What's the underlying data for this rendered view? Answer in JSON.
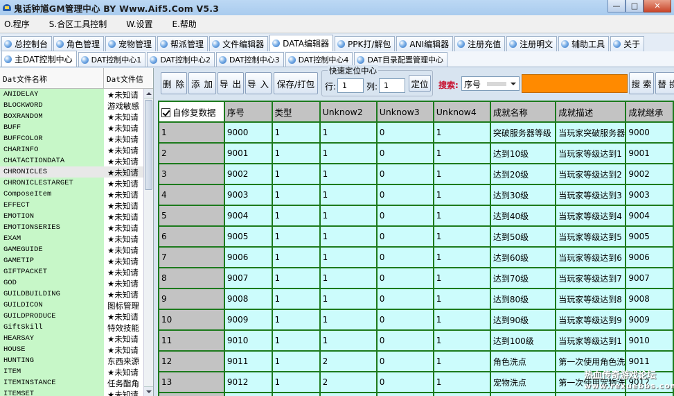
{
  "window": {
    "title": "鬼话钟馗GM管理中心 BY Www.Aif5.Com  V5.3",
    "controls": [
      "—",
      "□",
      "✕"
    ]
  },
  "menu": [
    "O.程序",
    "S.合区工具控制",
    "W.设置",
    "E.帮助"
  ],
  "main_tabs": [
    {
      "label": "总控制台",
      "active": false
    },
    {
      "label": "角色管理",
      "active": false
    },
    {
      "label": "宠物管理",
      "active": false
    },
    {
      "label": "帮派管理",
      "active": false
    },
    {
      "label": "文件编辑器",
      "active": false
    },
    {
      "label": "DATA编辑器",
      "active": true
    },
    {
      "label": "PPK打/解包",
      "active": false
    },
    {
      "label": "ANI编辑器",
      "active": false
    },
    {
      "label": "注册充值",
      "active": false
    },
    {
      "label": "注册明文",
      "active": false
    },
    {
      "label": "辅助工具",
      "active": false
    },
    {
      "label": "关于",
      "active": false
    }
  ],
  "sub_tabs": [
    {
      "label": "主DAT控制中心",
      "active": true
    },
    {
      "label": "DAT控制中心1",
      "active": false
    },
    {
      "label": "DAT控制中心2",
      "active": false
    },
    {
      "label": "DAT控制中心3",
      "active": false
    },
    {
      "label": "DAT控制中心4",
      "active": false
    },
    {
      "label": "DAT目录配置管理中心",
      "active": false
    }
  ],
  "file_list": {
    "headers": [
      "Dat文件名称",
      "Dat文件信"
    ],
    "rows": [
      {
        "name": "ANIDELAY",
        "desc": "★未知请"
      },
      {
        "name": "BLOCKWORD",
        "desc": "游戏敏感"
      },
      {
        "name": "BOXRANDOM",
        "desc": "★未知请"
      },
      {
        "name": "BUFF",
        "desc": "★未知请"
      },
      {
        "name": "BUFFCOLOR",
        "desc": "★未知请"
      },
      {
        "name": "CHARINFO",
        "desc": "★未知请"
      },
      {
        "name": "CHATACTIONDATA",
        "desc": "★未知请"
      },
      {
        "name": "CHRONICLES",
        "desc": "★未知请",
        "selected": true
      },
      {
        "name": "CHRONICLESTARGET",
        "desc": "★未知请"
      },
      {
        "name": "ComposeItem",
        "desc": "★未知请"
      },
      {
        "name": "EFFECT",
        "desc": "★未知请"
      },
      {
        "name": "EMOTION",
        "desc": "★未知请"
      },
      {
        "name": "EMOTIONSERIES",
        "desc": "★未知请"
      },
      {
        "name": "EXAM",
        "desc": "★未知请"
      },
      {
        "name": "GAMEGUIDE",
        "desc": "★未知请"
      },
      {
        "name": "GAMETIP",
        "desc": "★未知请"
      },
      {
        "name": "GIFTPACKET",
        "desc": "★未知请"
      },
      {
        "name": "GOD",
        "desc": "★未知请"
      },
      {
        "name": "GUILDBUILDING",
        "desc": "★未知请"
      },
      {
        "name": "GUILDICON",
        "desc": "图标管理"
      },
      {
        "name": "GUILDPRODUCE",
        "desc": "★未知请"
      },
      {
        "name": "GiftSkill",
        "desc": "特效技能"
      },
      {
        "name": "HEARSAY",
        "desc": "★未知请"
      },
      {
        "name": "HOUSE",
        "desc": "★未知请"
      },
      {
        "name": "HUNTING",
        "desc": "东西来源"
      },
      {
        "name": "ITEM",
        "desc": "★未知请"
      },
      {
        "name": "ITEMINSTANCE",
        "desc": "任务酯角"
      },
      {
        "name": "ITEMSET",
        "desc": "★未知请"
      }
    ]
  },
  "toolbar": {
    "delete": "删 除",
    "add": "添 加",
    "export": "导 出",
    "import": "导 入",
    "save_pack": "保存/打包",
    "locate_group": "快速定位中心",
    "row_label": "行:",
    "row_value": "1",
    "col_label": "列:",
    "col_value": "1",
    "locate": "定位",
    "search_label": "搜索:",
    "search_field": "序号",
    "search_value": "",
    "search_btn": "搜 索",
    "replace_btn": "替 换"
  },
  "grid": {
    "auto_fix_label": "自修复数据",
    "auto_fix_checked": true,
    "columns": [
      "序号",
      "类型",
      "Unknow2",
      "Unknow3",
      "Unknow4",
      "成就名称",
      "成就描述",
      "成就继承"
    ],
    "rows": [
      [
        "1",
        "9000",
        "1",
        "1",
        "0",
        "1",
        "突破服务器等级",
        "当玩家突破服务器",
        "9000"
      ],
      [
        "2",
        "9001",
        "1",
        "1",
        "0",
        "1",
        "达到10级",
        "当玩家等级达到1",
        "9001"
      ],
      [
        "3",
        "9002",
        "1",
        "1",
        "0",
        "1",
        "达到20级",
        "当玩家等级达到2",
        "9002"
      ],
      [
        "4",
        "9003",
        "1",
        "1",
        "0",
        "1",
        "达到30级",
        "当玩家等级达到3",
        "9003"
      ],
      [
        "5",
        "9004",
        "1",
        "1",
        "0",
        "1",
        "达到40级",
        "当玩家等级达到4",
        "9004"
      ],
      [
        "6",
        "9005",
        "1",
        "1",
        "0",
        "1",
        "达到50级",
        "当玩家等级达到5",
        "9005"
      ],
      [
        "7",
        "9006",
        "1",
        "1",
        "0",
        "1",
        "达到60级",
        "当玩家等级达到6",
        "9006"
      ],
      [
        "8",
        "9007",
        "1",
        "1",
        "0",
        "1",
        "达到70级",
        "当玩家等级达到7",
        "9007"
      ],
      [
        "9",
        "9008",
        "1",
        "1",
        "0",
        "1",
        "达到80级",
        "当玩家等级达到8",
        "9008"
      ],
      [
        "10",
        "9009",
        "1",
        "1",
        "0",
        "1",
        "达到90级",
        "当玩家等级达到9",
        "9009"
      ],
      [
        "11",
        "9010",
        "1",
        "1",
        "0",
        "1",
        "达到100级",
        "当玩家等级达到1",
        "9010"
      ],
      [
        "12",
        "9011",
        "1",
        "2",
        "0",
        "1",
        "角色洗点",
        "第一次使用角色洗",
        "9011"
      ],
      [
        "13",
        "9012",
        "1",
        "2",
        "0",
        "1",
        "宠物洗点",
        "第一次使用宠物洗",
        "9012"
      ],
      [
        "",
        "",
        "",
        "",
        "",
        "",
        "",
        "",
        ""
      ]
    ]
  },
  "watermark": {
    "line1": "热血传奇游戏论坛",
    "line2": "www.rexuebbs.com"
  }
}
